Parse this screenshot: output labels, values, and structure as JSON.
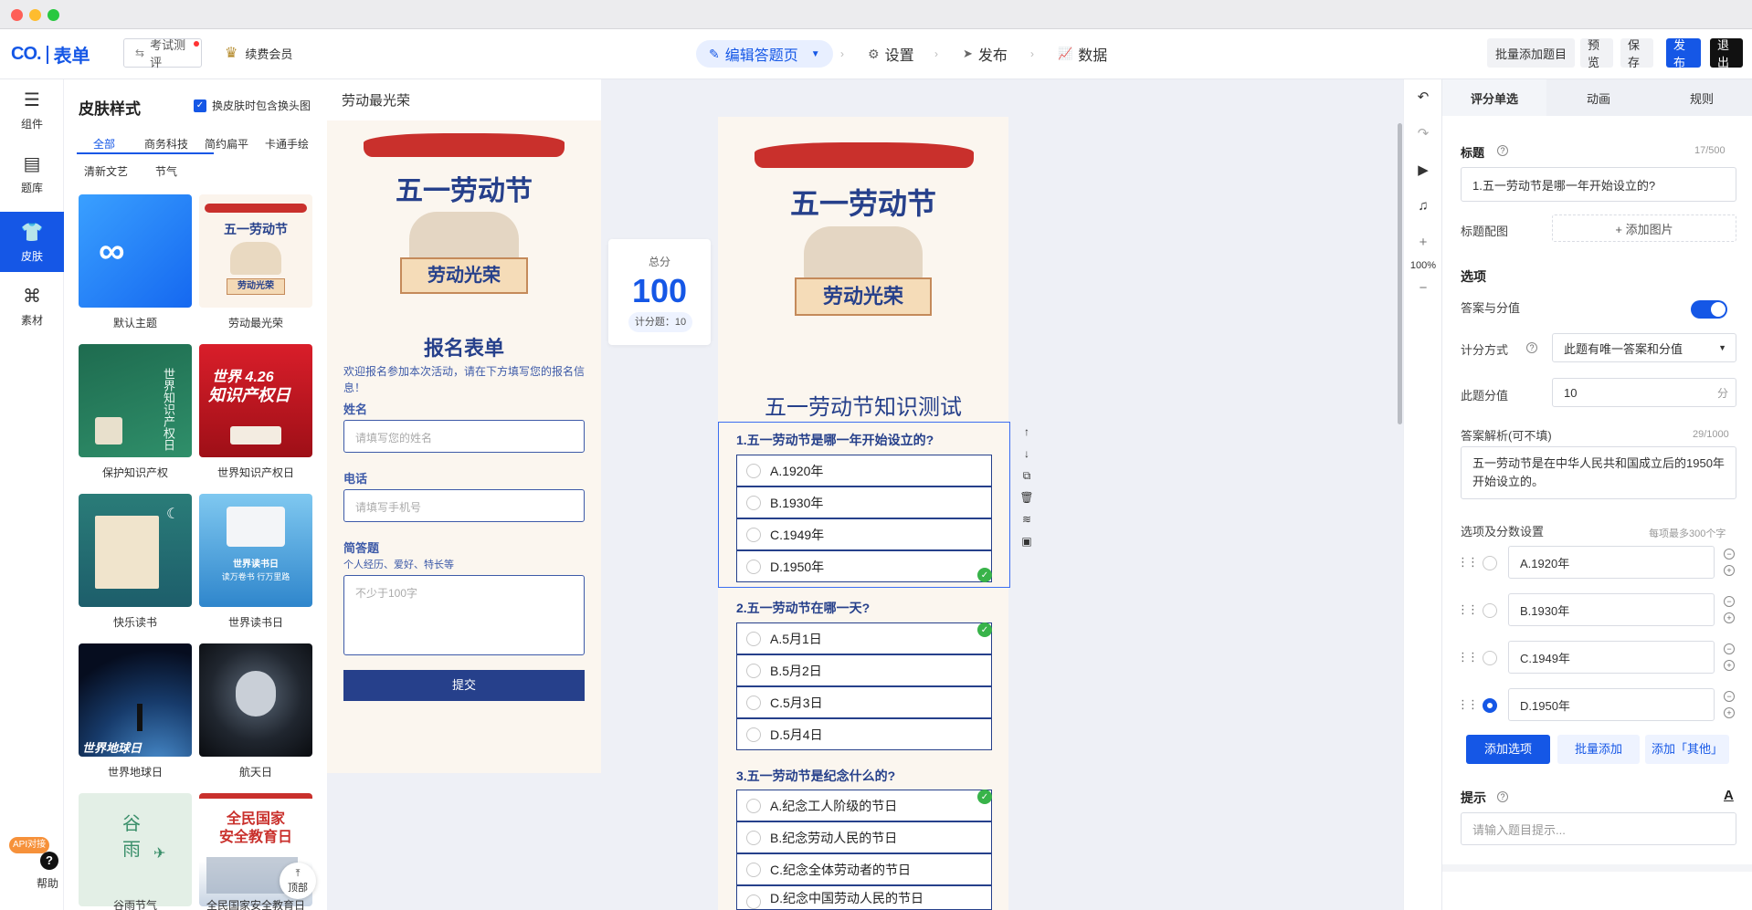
{
  "header": {
    "logo_mark": "CO.",
    "logo_name": "表单",
    "exam_btn": "考试测评",
    "vip_label": "续费会员",
    "nav_edit": "编辑答题页",
    "nav_settings": "设置",
    "nav_publish": "发布",
    "nav_data": "数据",
    "batch_add": "批量添加题目",
    "preview": "预览",
    "save": "保存",
    "publish": "发布",
    "exit": "退出"
  },
  "iconbar": {
    "items": [
      {
        "label": "组件",
        "icon": "component-icon"
      },
      {
        "label": "题库",
        "icon": "question-bank-icon"
      },
      {
        "label": "皮肤",
        "icon": "tshirt-icon"
      },
      {
        "label": "素材",
        "icon": "material-icon"
      }
    ],
    "api_badge": "API对接",
    "help": "帮助"
  },
  "skin": {
    "title": "皮肤样式",
    "checkbox_label": "换皮肤时包含换头图",
    "tabs": [
      "全部",
      "商务科技",
      "简约扁平",
      "卡通手绘",
      "清新文艺",
      "节气"
    ],
    "themes": [
      {
        "label": "默认主题"
      },
      {
        "label": "劳动最光荣",
        "thumb_line1": "五一劳动节",
        "thumb_line2": "劳动光荣"
      },
      {
        "label": "保护知识产权",
        "thumb_text": "世界知识产权日"
      },
      {
        "label": "世界知识产权日",
        "thumb_line1": "世界 4.26",
        "thumb_line2": "知识产权日"
      },
      {
        "label": "快乐读书"
      },
      {
        "label": "世界读书日",
        "thumb_line1": "世界读书日",
        "thumb_line2": "读万卷书 行万里路"
      },
      {
        "label": "世界地球日",
        "thumb_text": "世界地球日"
      },
      {
        "label": "航天日"
      },
      {
        "label": "谷雨节气",
        "thumb_text": "谷雨"
      },
      {
        "label": "全民国家安全教育日",
        "thumb_line1": "全民国家",
        "thumb_line2": "安全教育日"
      }
    ],
    "top_btn": "顶部"
  },
  "form_preview": {
    "header_title": "劳动最光荣",
    "banner_title": "五一劳动节",
    "banner_sign": "劳动光荣",
    "form_title": "报名表单",
    "desc": "欢迎报名参加本次活动，请在下方填写您的报名信息！",
    "name_label": "姓名",
    "name_placeholder": "请填写您的姓名",
    "phone_label": "电话",
    "phone_placeholder": "请填写手机号",
    "essay_label": "简答题",
    "essay_hint": "个人经历、爱好、特长等",
    "essay_placeholder": "不少于100字",
    "submit": "提交"
  },
  "score": {
    "label": "总分",
    "value": "100",
    "count": "计分题：10"
  },
  "quiz": {
    "banner_title": "五一劳动节",
    "banner_sign": "劳动光荣",
    "title": "五一劳动节知识测试",
    "questions": [
      {
        "title": "1.五一劳动节是哪一年开始设立的?",
        "options": [
          "A.1920年",
          "B.1930年",
          "C.1949年",
          "D.1950年"
        ],
        "correct": 3
      },
      {
        "title": "2.五一劳动节在哪一天?",
        "options": [
          "A.5月1日",
          "B.5月2日",
          "C.5月3日",
          "D.5月4日"
        ],
        "correct": 0
      },
      {
        "title": "3.五一劳动节是纪念什么的?",
        "options": [
          "A.纪念工人阶级的节日",
          "B.纪念劳动人民的节日",
          "C.纪念全体劳动者的节日",
          "D.纪念中国劳动人民的节日"
        ],
        "correct": 0
      }
    ]
  },
  "toolbar_right": {
    "zoom": "100%"
  },
  "props": {
    "tabs": [
      "评分单选",
      "动画",
      "规则"
    ],
    "title_label": "标题",
    "title_count": "17/500",
    "title_value": "1.五一劳动节是哪一年开始设立的?",
    "image_label": "标题配图",
    "add_image": "+ 添加图片",
    "options_heading": "选项",
    "answer_score_label": "答案与分值",
    "scoring_method_label": "计分方式",
    "scoring_method_value": "此题有唯一答案和分值",
    "score_label": "此题分值",
    "score_value": "10",
    "score_unit": "分",
    "explain_label": "答案解析(可不填)",
    "explain_count": "29/1000",
    "explain_value": "五一劳动节是在中华人民共和国成立后的1950年开始设立的。",
    "options_setting_label": "选项及分数设置",
    "options_limit": "每项最多300个字",
    "options": [
      "A.1920年",
      "B.1930年",
      "C.1949年",
      "D.1950年"
    ],
    "selected_option": 3,
    "add_option": "添加选项",
    "batch_add": "批量添加",
    "add_other": "添加「其他」",
    "hint_label": "提示",
    "hint_placeholder": "请输入题目提示..."
  },
  "colors": {
    "accent": "#1557e6",
    "navy": "#26408b",
    "success": "#38b349"
  }
}
